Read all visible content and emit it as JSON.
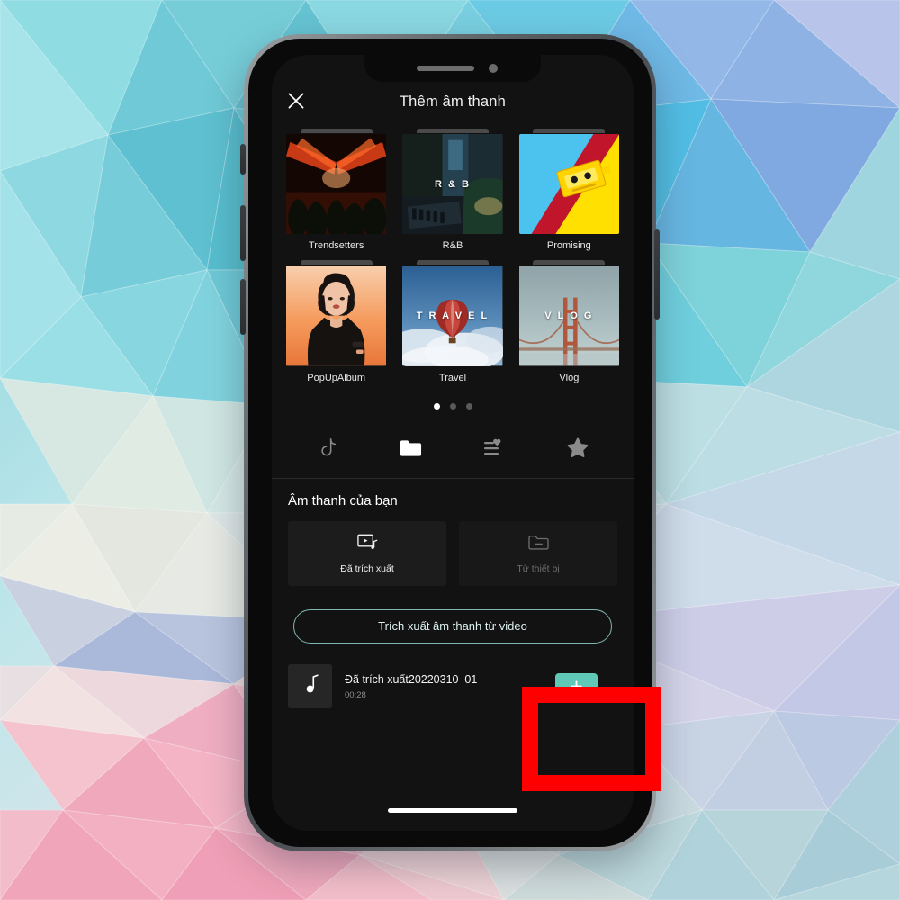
{
  "app": {
    "header": {
      "title": "Thêm âm thanh",
      "close_icon": "close-icon"
    },
    "albums": [
      {
        "label": "Trendsetters",
        "overlay": "",
        "art": "concert-red-lights"
      },
      {
        "label": "R&B",
        "overlay": "R & B",
        "art": "studio-dark"
      },
      {
        "label": "Promising",
        "overlay": "",
        "art": "yellow-cassette"
      },
      {
        "label": "PopUpAlbum",
        "overlay": "",
        "art": "portrait-orange"
      },
      {
        "label": "Travel",
        "overlay": "T R A V E L",
        "art": "hot-air-balloon"
      },
      {
        "label": "Vlog",
        "overlay": "V L O G",
        "art": "golden-gate-bridge"
      }
    ],
    "pager": {
      "total": 3,
      "active_index": 0
    },
    "tabs": [
      {
        "name": "tab-tiktok",
        "icon": "tiktok-note-icon",
        "active": false
      },
      {
        "name": "tab-folder",
        "icon": "folder-icon",
        "active": true
      },
      {
        "name": "tab-playlist",
        "icon": "playlist-heart-icon",
        "active": false
      },
      {
        "name": "tab-favorites",
        "icon": "star-icon",
        "active": false
      }
    ],
    "your_sounds": {
      "title": "Âm thanh của bạn",
      "sources": [
        {
          "label": "Đã trích xuất",
          "icon": "video-music-icon",
          "enabled": true
        },
        {
          "label": "Từ thiết bị",
          "icon": "folder-outline-icon",
          "enabled": false
        }
      ]
    },
    "extract_button": {
      "label": "Trích xuất âm thanh từ video"
    },
    "track": {
      "title": "Đã trích xuất20220310–01",
      "duration": "00:28",
      "thumb_icon": "music-note-icon",
      "add_label": "+"
    }
  },
  "annotation": {
    "type": "red-rectangle-highlight",
    "color": "#fe0000",
    "target": "add-track-button"
  },
  "colors": {
    "accent_teal": "#5fc8b6",
    "screen_bg": "#121212",
    "highlight_red": "#fe0000",
    "phone_bezel": "#6d7276"
  }
}
